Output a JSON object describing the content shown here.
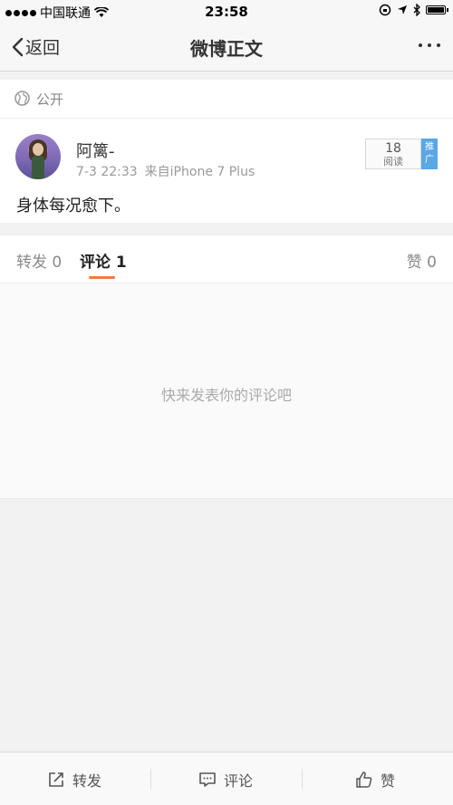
{
  "status_bar": {
    "carrier": "中国联通",
    "time": "23:58",
    "signal_bars": 4
  },
  "nav": {
    "back_label": "返回",
    "title": "微博正文"
  },
  "visibility": {
    "label": "公开",
    "icon": "globe-icon"
  },
  "post": {
    "username": "阿篱-",
    "time": "7-3 22:33",
    "source": "来自iPhone 7 Plus",
    "read_count": "18",
    "read_label": "阅读",
    "promo_label": "推广",
    "text": "身体每况愈下。"
  },
  "tabs": {
    "repost": "转发 0",
    "comment": "评论 1",
    "like": "赞 0"
  },
  "empty_message": "快来发表你的评论吧",
  "bottom_bar": {
    "repost": "转发",
    "comment": "评论",
    "like": "赞"
  },
  "colors": {
    "accent": "#f07b3f",
    "promo": "#5aa7e6"
  }
}
